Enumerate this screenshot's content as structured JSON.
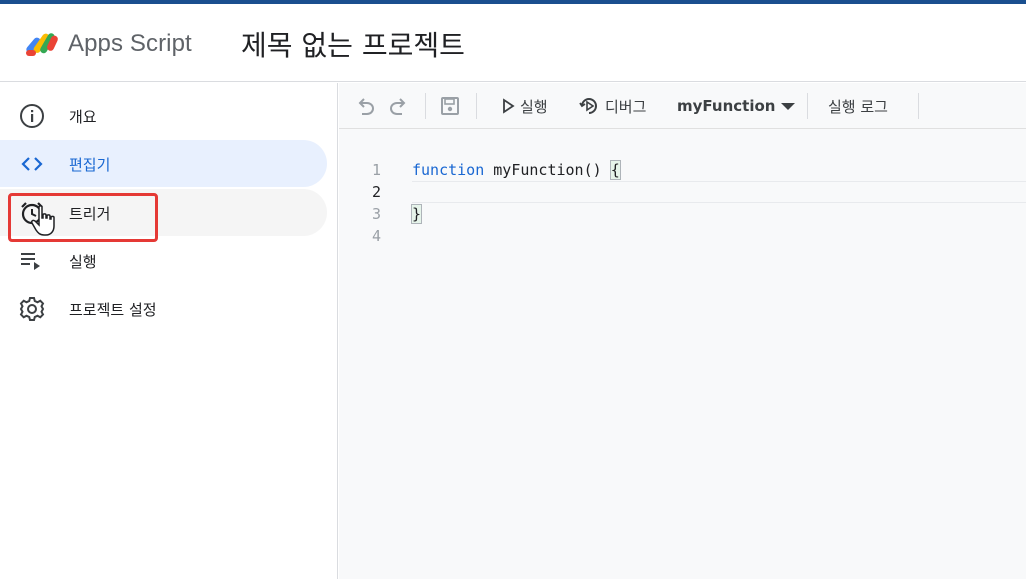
{
  "app": {
    "name": "Apps Script",
    "project_title": "제목 없는 프로젝트"
  },
  "sidebar": {
    "items": [
      {
        "label": "개요",
        "icon": "info-icon"
      },
      {
        "label": "편집기",
        "icon": "code-icon",
        "state": "active"
      },
      {
        "label": "트리거",
        "icon": "alarm-clock-icon",
        "state": "hover"
      },
      {
        "label": "실행",
        "icon": "executions-icon"
      },
      {
        "label": "프로젝트 설정",
        "icon": "gear-icon"
      }
    ]
  },
  "toolbar": {
    "undo_icon": "undo-icon",
    "redo_icon": "redo-icon",
    "save_icon": "save-icon",
    "run_label": "실행",
    "debug_label": "디버그",
    "function_select": "myFunction",
    "log_label": "실행 로그"
  },
  "editor": {
    "lines": [
      {
        "num": "1",
        "keyword": "function",
        "rest": " myFunction() ",
        "brace": "{"
      },
      {
        "num": "2",
        "text": ""
      },
      {
        "num": "3",
        "brace": "}"
      },
      {
        "num": "4",
        "text": ""
      }
    ],
    "current_line": 2
  },
  "colors": {
    "accent": "#1967d2",
    "active_nav_bg": "#e8f0fe",
    "highlight_box": "#e53935",
    "top_line": "#1a4f8f"
  }
}
